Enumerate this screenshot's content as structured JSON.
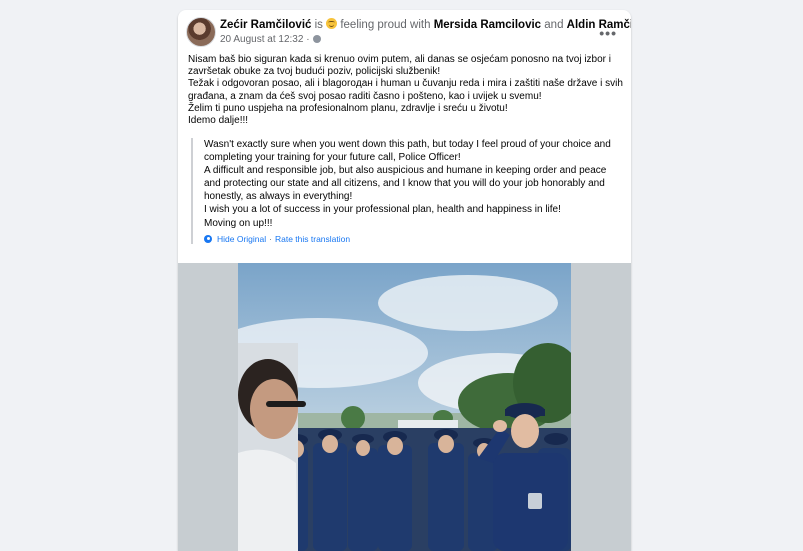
{
  "post": {
    "author": "Zećir Ramčilović",
    "is_text": "is",
    "feeling_text": "feeling proud with",
    "tagged_1": "Mersida Ramcilovic",
    "and_text": "and",
    "tagged_2": "Aldin Ramčilović.",
    "date": "20 August at 12:32",
    "separator": "·",
    "more_icon": "•••",
    "original_text": "Nisam baš bio siguran kada si krenuo ovim putem, ali danas se osjećam ponosno na tvoj izbor i\nzavršetak obuke za tvoj budući poziv, policijski službenik!\nTežak i odgovoran posao, ali i blagoroдан i human u čuvanju reda i mira i zaštiti naše države i svih\ngrađana, a znam da ćeš svoj posao raditi časno i pošteno, kao i uvijek u svemu!\nŽelim ti puno uspjeha na profesionalnom planu, zdravlje i sreću u životu!\nIdemo dalje!!!",
    "translation_text": "Wasn't exactly sure when you went down this path, but today I feel proud of your choice and\ncompleting your training for your future call, Police Officer!\nA difficult and responsible job, but also auspicious and humane in keeping order and peace\nand protecting our state and all citizens, and I know that you will do your job honorably and\nhonestly, as always in everything!\nI wish you a lot of success in your professional plan, health and happiness in life!\nMoving on up!!!",
    "hide_original": "Hide Original",
    "link_separator": "·",
    "rate_translation": "Rate this translation"
  },
  "colors": {
    "page_bg": "#f0f2f5",
    "card_bg": "#ffffff",
    "link_blue": "#1877f2",
    "secondary_text": "#65676b",
    "uniform_blue": "#1f3a6e"
  },
  "icons": {
    "avatar": "avatar",
    "feeling": "proud-emoji-icon",
    "audience": "globe-icon",
    "more": "more-options-icon",
    "translate": "translate-gear-icon"
  }
}
